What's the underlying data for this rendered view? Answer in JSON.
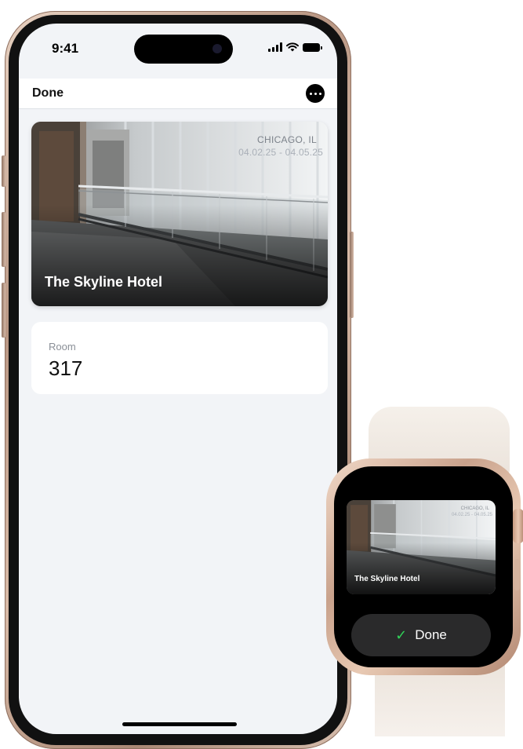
{
  "phone": {
    "status_bar": {
      "time": "9:41"
    },
    "nav": {
      "done_label": "Done",
      "more_icon": "ellipsis-circle-icon"
    },
    "hotel_card": {
      "city": "CHICAGO, IL",
      "dates": "04.02.25 - 04.05.25",
      "name": "The Skyline Hotel"
    },
    "room": {
      "label": "Room",
      "value": "317"
    }
  },
  "watch": {
    "hotel_card": {
      "city": "CHICAGO, IL",
      "dates": "04.02.25 - 04.05.25",
      "name": "The Skyline Hotel"
    },
    "done_button": {
      "icon": "checkmark-icon",
      "check_glyph": "✓",
      "label": "Done"
    }
  },
  "colors": {
    "phone_frame": "#c5a48f",
    "screen_background": "#f2f4f7",
    "watch_check": "#30d158",
    "watch_button": "#2a2a2b"
  }
}
